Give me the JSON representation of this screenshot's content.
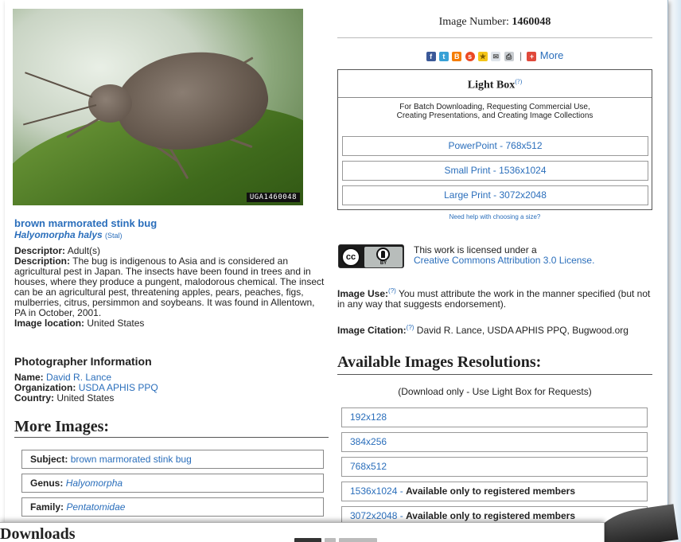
{
  "image": {
    "code": "UGA1460048",
    "common_name": "brown marmorated stink bug",
    "scientific_name": "Halyomorpha halys",
    "author": "(Stal)"
  },
  "descriptor": {
    "label": "Descriptor:",
    "value": "Adult(s)"
  },
  "description": {
    "label": "Description:",
    "value": "The bug is indigenous to Asia and is considered an agricultural pest in Japan. The insects have been found in trees and in houses, where they produce a pungent, malodorous chemical. The insect can be an agricultural pest, threatening apples, pears, peaches, figs, mulberries, citrus, persimmon and soybeans. It was found in Allentown, PA in October, 2001."
  },
  "image_location": {
    "label": "Image location:",
    "value": "United States"
  },
  "photographer": {
    "heading": "Photographer Information",
    "name_label": "Name:",
    "name": "David R. Lance",
    "org_label": "Organization:",
    "organization": "USDA APHIS PPQ",
    "country_label": "Country:",
    "country": "United States"
  },
  "more_images": {
    "title": "More Images:",
    "rows": [
      {
        "label": "Subject:",
        "value": "brown marmorated stink bug"
      },
      {
        "label": "Genus:",
        "value": "Halyomorpha"
      },
      {
        "label": "Family:",
        "value": "Pentatomidae"
      }
    ]
  },
  "image_number": {
    "label": "Image Number:",
    "value": "1460048"
  },
  "share": {
    "icons": [
      "facebook-icon",
      "twitter-icon",
      "blogger-icon",
      "stumbleupon-icon",
      "favorites-icon",
      "email-icon",
      "print-icon"
    ],
    "separator": "|",
    "more_label": "More"
  },
  "lightbox": {
    "title": "Light Box",
    "help_mark": "(?)",
    "description_line1": "For Batch Downloading, Requesting Commercial Use,",
    "description_line2": "Creating Presentations, and Creating Image Collections",
    "buttons": [
      "PowerPoint - 768x512",
      "Small Print - 1536x1024",
      "Large Print - 3072x2048"
    ],
    "help_link": "Need help with choosing a size?"
  },
  "license": {
    "badge_text": "cc",
    "badge_sub": "BY",
    "line1": "This work is licensed under a",
    "link": "Creative Commons Attribution 3.0 License."
  },
  "image_use": {
    "label": "Image Use:",
    "help_mark": "(?)",
    "value": "You must attribute the work in the manner specified (but not in any way that suggests endorsement)."
  },
  "image_citation": {
    "label": "Image Citation:",
    "help_mark": "(?)",
    "value": "David R. Lance, USDA APHIS PPQ, Bugwood.org"
  },
  "available": {
    "title": "Available Images Resolutions:",
    "subtitle": "(Download only - Use Light Box for Requests)",
    "resolutions": [
      {
        "res": "192x128",
        "note": ""
      },
      {
        "res": "384x256",
        "note": ""
      },
      {
        "res": "768x512",
        "note": ""
      },
      {
        "res": "1536x1024",
        "sep": " - ",
        "note": "Available only to registered members"
      },
      {
        "res": "3072x2048",
        "sep": " - ",
        "note": "Available only to registered members"
      }
    ]
  },
  "overlay": {
    "title": "Downloads"
  },
  "colors": {
    "link": "#2a6ebb",
    "text": "#222222",
    "border": "#999999"
  }
}
